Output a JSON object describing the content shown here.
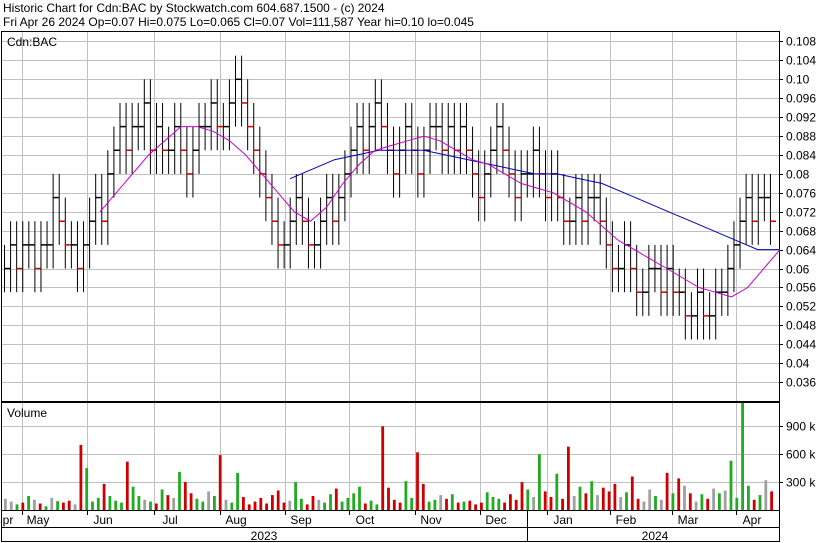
{
  "header": {
    "line1": "Historic Chart for Cdn:BAC by Stockwatch.com 604.687.1500 - (c) 2024",
    "line2": "Fri Apr 26 2024   Op=0.07  Hi=0.075  Lo=0.065  Cl=0.07  Vol=111,587  Year hi=0.10  lo=0.045"
  },
  "chart_data": [
    {
      "type": "line",
      "panel_label": "Cdn:BAC",
      "ylim": [
        0.032,
        0.11
      ],
      "yticks": [
        "0.108",
        "0.104",
        "0.10",
        "0.096",
        "0.092",
        "0.088",
        "0.084",
        "0.08",
        "0.076",
        "0.072",
        "0.068",
        "0.064",
        "0.06",
        "0.056",
        "0.052",
        "0.048",
        "0.044",
        "0.04",
        "0.036"
      ],
      "grid": true,
      "x_months": [
        "pr",
        "May",
        "Jun",
        "Jul",
        "Aug",
        "Sep",
        "Oct",
        "Nov",
        "Dec",
        "Jan",
        "Feb",
        "Mar",
        "Apr"
      ],
      "x_years": [
        "2023",
        "2024"
      ],
      "colors": {
        "up": "#000000",
        "down": "#cc0000",
        "ma_short": "#cc00cc",
        "ma_long": "#0000bb",
        "grid": "#c0c0c0"
      },
      "price_series": {
        "name": "",
        "note_semantics": "daily close, ordered oldest to newest",
        "close": [
          0.06,
          0.065,
          0.06,
          0.065,
          0.065,
          0.06,
          0.065,
          0.065,
          0.075,
          0.07,
          0.065,
          0.065,
          0.06,
          0.065,
          0.07,
          0.075,
          0.07,
          0.08,
          0.085,
          0.09,
          0.085,
          0.09,
          0.09,
          0.095,
          0.085,
          0.09,
          0.085,
          0.085,
          0.09,
          0.085,
          0.08,
          0.085,
          0.09,
          0.09,
          0.095,
          0.09,
          0.09,
          0.095,
          0.1,
          0.095,
          0.09,
          0.085,
          0.08,
          0.075,
          0.07,
          0.065,
          0.065,
          0.07,
          0.075,
          0.07,
          0.065,
          0.065,
          0.07,
          0.075,
          0.07,
          0.075,
          0.08,
          0.085,
          0.09,
          0.085,
          0.09,
          0.095,
          0.09,
          0.085,
          0.08,
          0.085,
          0.09,
          0.085,
          0.08,
          0.085,
          0.09,
          0.09,
          0.085,
          0.09,
          0.085,
          0.09,
          0.085,
          0.08,
          0.075,
          0.08,
          0.085,
          0.09,
          0.085,
          0.08,
          0.075,
          0.08,
          0.08,
          0.085,
          0.08,
          0.075,
          0.08,
          0.075,
          0.07,
          0.07,
          0.075,
          0.07,
          0.075,
          0.075,
          0.07,
          0.065,
          0.06,
          0.06,
          0.065,
          0.06,
          0.055,
          0.055,
          0.06,
          0.06,
          0.055,
          0.06,
          0.055,
          0.055,
          0.05,
          0.05,
          0.055,
          0.05,
          0.05,
          0.055,
          0.055,
          0.06,
          0.065,
          0.07,
          0.075,
          0.07,
          0.075,
          0.075,
          0.07
        ],
        "ylabel": ""
      },
      "ma_short": [
        0.072,
        0.076,
        0.08,
        0.084,
        0.087,
        0.09,
        0.09,
        0.089,
        0.087,
        0.084,
        0.08,
        0.076,
        0.072,
        0.07,
        0.073,
        0.078,
        0.082,
        0.085,
        0.086,
        0.087,
        0.088,
        0.087,
        0.085,
        0.083,
        0.082,
        0.08,
        0.078,
        0.077,
        0.076,
        0.074,
        0.072,
        0.069,
        0.066,
        0.064,
        0.062,
        0.06,
        0.058,
        0.056,
        0.055,
        0.054,
        0.056,
        0.06,
        0.064
      ],
      "ma_long": [
        0.079,
        0.081,
        0.083,
        0.084,
        0.085,
        0.085,
        0.085,
        0.084,
        0.083,
        0.082,
        0.081,
        0.08,
        0.08,
        0.079,
        0.078,
        0.076,
        0.074,
        0.072,
        0.07,
        0.068,
        0.066,
        0.064,
        0.064
      ]
    },
    {
      "type": "bar",
      "panel_label": "Volume",
      "ylim": [
        0,
        1150000
      ],
      "yticks": [
        "900 k",
        "600 k",
        "300 k"
      ],
      "colors": {
        "up": "#22aa22",
        "down": "#cc0000",
        "flat": "#a0a0a0"
      },
      "volume_values": [
        120,
        90,
        60,
        80,
        150,
        110,
        70,
        40,
        130,
        95,
        80,
        100,
        60,
        700,
        450,
        90,
        130,
        280,
        150,
        100,
        80,
        520,
        250,
        150,
        110,
        90,
        70,
        220,
        160,
        130,
        410,
        300,
        180,
        120,
        90,
        200,
        150,
        590,
        110,
        80,
        400,
        140,
        60,
        90,
        130,
        70,
        160,
        210,
        80,
        100,
        300,
        120,
        60,
        150,
        110,
        80,
        170,
        230,
        90,
        130,
        180,
        250,
        70,
        100,
        60,
        900,
        240,
        110,
        80,
        310,
        130,
        620,
        280,
        90,
        110,
        160,
        120,
        170,
        80,
        90,
        100,
        60,
        80,
        190,
        140,
        120,
        80,
        170,
        110,
        300,
        220,
        140,
        600,
        200,
        140,
        390,
        120,
        680,
        150,
        250,
        180,
        310,
        160,
        240,
        200,
        280,
        140,
        190,
        360,
        120,
        90,
        220,
        150,
        110,
        400,
        180,
        340,
        260,
        180,
        90,
        170,
        120,
        230,
        180,
        210,
        530,
        130,
        1150,
        260,
        110,
        160,
        320,
        200
      ],
      "volume_units": "shares"
    }
  ]
}
